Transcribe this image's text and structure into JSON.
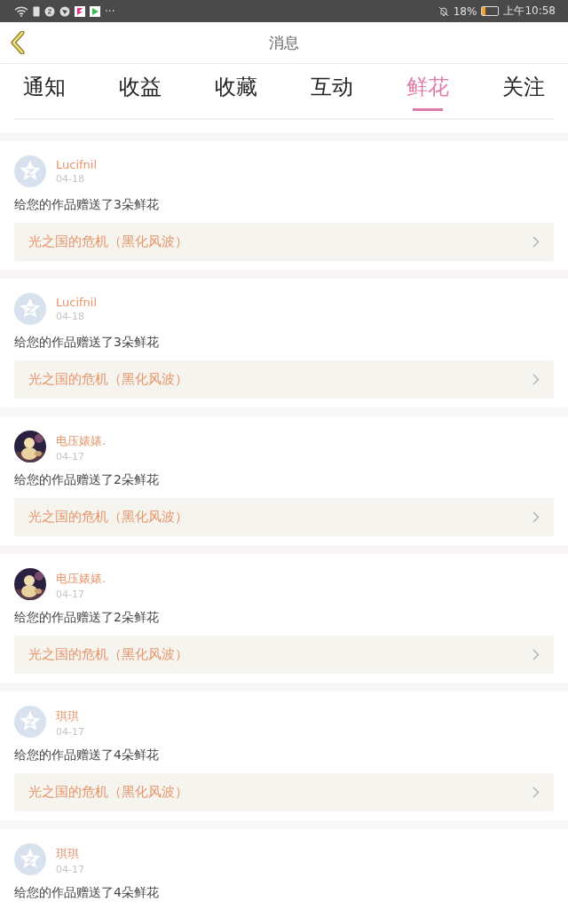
{
  "status_bar": {
    "more": "···",
    "battery_percent": "18%",
    "time": "上午10:58"
  },
  "header": {
    "title": "消息"
  },
  "tabs": [
    {
      "label": "通知",
      "selected": false
    },
    {
      "label": "收益",
      "selected": false
    },
    {
      "label": "收藏",
      "selected": false
    },
    {
      "label": "互动",
      "selected": false
    },
    {
      "label": "鲜花",
      "selected": true
    },
    {
      "label": "关注",
      "selected": false
    }
  ],
  "messages": [
    {
      "kind": "default_avatar",
      "name": "Lucifnil",
      "date": "04-18",
      "text": "给您的作品赠送了3朵鲜花",
      "work": "光之国的危机（黑化风波）"
    },
    {
      "kind": "default_avatar",
      "name": "Lucifnil",
      "date": "04-18",
      "text": "给您的作品赠送了3朵鲜花",
      "work": "光之国的危机（黑化风波）"
    },
    {
      "kind": "photo_avatar",
      "name": "电压婊婊.",
      "date": "04-17",
      "text": "给您的作品赠送了2朵鲜花",
      "work": "光之国的危机（黑化风波）"
    },
    {
      "kind": "photo_avatar",
      "name": "电压婊婊.",
      "date": "04-17",
      "text": "给您的作品赠送了2朵鲜花",
      "work": "光之国的危机（黑化风波）"
    },
    {
      "kind": "default_avatar",
      "name": "琪琪",
      "date": "04-17",
      "text": "给您的作品赠送了4朵鲜花",
      "work": "光之国的危机（黑化风波）"
    },
    {
      "kind": "default_avatar",
      "name": "琪琪",
      "date": "04-17",
      "text": "给您的作品赠送了4朵鲜花"
    }
  ]
}
